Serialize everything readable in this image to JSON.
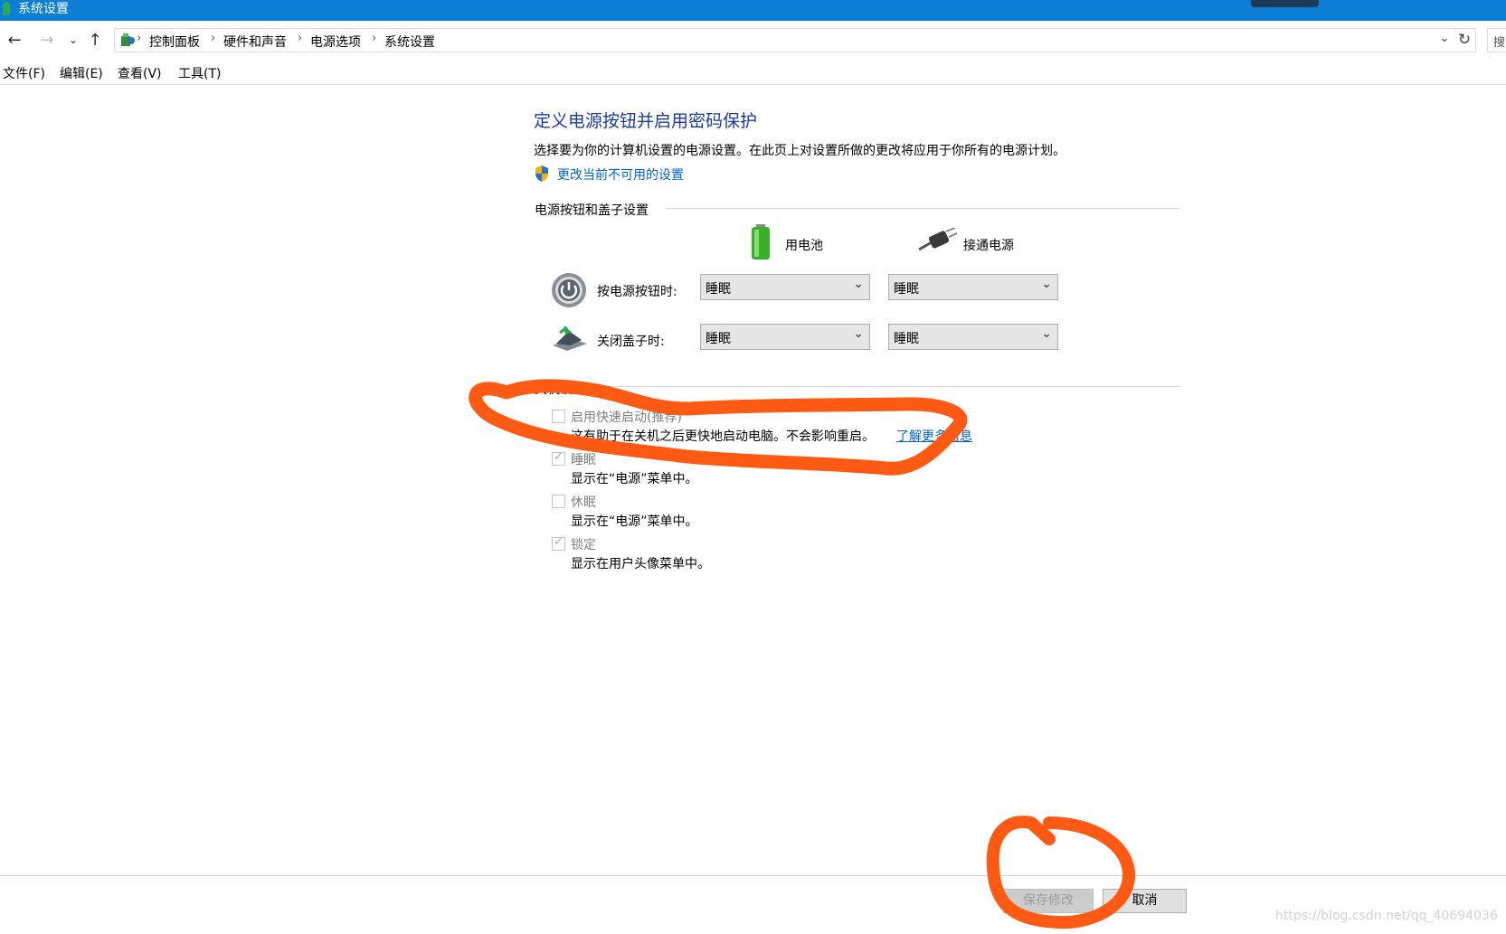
{
  "window": {
    "title": "系统设置"
  },
  "nav": {
    "breadcrumbs": [
      "控制面板",
      "硬件和声音",
      "电源选项",
      "系统设置"
    ],
    "search_partial": "搜"
  },
  "menu": [
    "文件(F)",
    "编辑(E)",
    "查看(V)",
    "工具(T)"
  ],
  "page": {
    "title": "定义电源按钮并启用密码保护",
    "description": "选择要为你的计算机设置的电源设置。在此页上对设置所做的更改将应用于你所有的电源计划。",
    "change_link": "更改当前不可用的设置"
  },
  "power_section": {
    "heading": "电源按钮和盖子设置",
    "col_battery": "用电池",
    "col_plugged": "接通电源",
    "rows": [
      {
        "label": "按电源按钮时:",
        "battery": "睡眠",
        "plugged": "睡眠"
      },
      {
        "label": "关闭盖子时:",
        "battery": "睡眠",
        "plugged": "睡眠"
      }
    ]
  },
  "shutdown_section": {
    "heading": "关机设置",
    "options": [
      {
        "label": "启用快速启动(推荐)",
        "desc": "这有助于在关机之后更快地启动电脑。不会影响重启。",
        "link": "了解更多信息",
        "checked": false
      },
      {
        "label": "睡眠",
        "desc": "显示在“电源”菜单中。",
        "checked": true
      },
      {
        "label": "休眠",
        "desc": "显示在“电源”菜单中。",
        "checked": false
      },
      {
        "label": "锁定",
        "desc": "显示在用户头像菜单中。",
        "checked": true
      }
    ]
  },
  "buttons": {
    "save": "保存修改",
    "cancel": "取消"
  },
  "watermark": "https://blog.csdn.net/qq_40694036",
  "colors": {
    "titlebar": "#0b7fd6",
    "title_text": "#1e3b99",
    "link": "#0066cc",
    "annotation": "#ff5a14"
  }
}
